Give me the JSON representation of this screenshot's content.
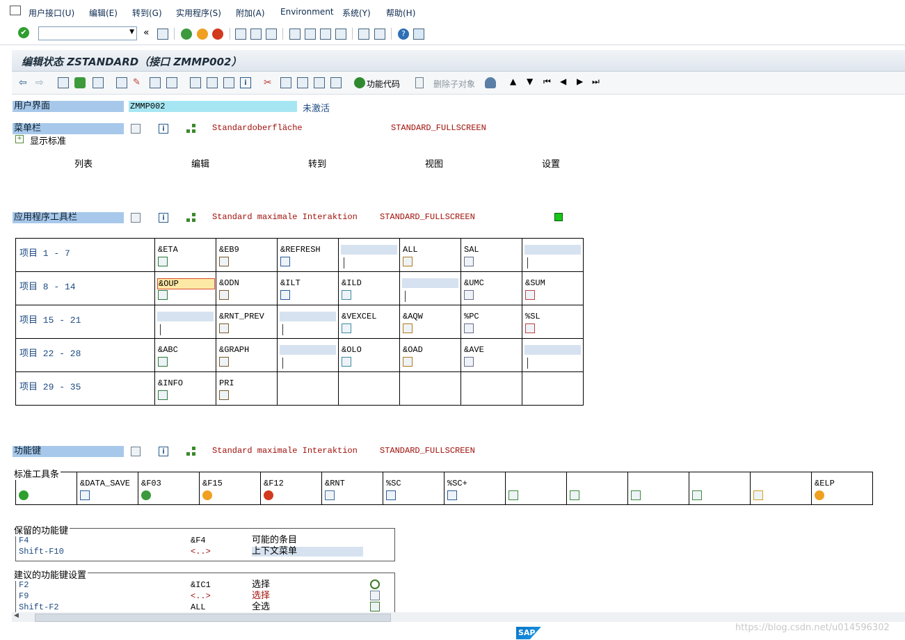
{
  "menu": [
    "用户接口(U)",
    "编辑(E)",
    "转到(G)",
    "实用程序(S)",
    "附加(A)",
    "Environment",
    "系统(Y)",
    "帮助(H)"
  ],
  "window_title": "编辑状态 ZSTANDARD（接口 ZMMP002）",
  "app_toolbar": {
    "func_code_label": "功能代码",
    "delete_sub_label": "删除子对象"
  },
  "ui": {
    "label": "用户界面",
    "value": "ZMMP002",
    "status": "未激活"
  },
  "menubar_section": {
    "label": "菜单栏",
    "text": "Standardoberfläche",
    "code": "STANDARD_FULLSCREEN",
    "show_standard": "显示标准",
    "items": [
      "列表",
      "编辑",
      "转到",
      "视图",
      "设置"
    ]
  },
  "app_toolbar_section": {
    "label": "应用程序工具栏",
    "text": "Standard maximale Interaktion",
    "code": "STANDARD_FULLSCREEN",
    "rows": [
      {
        "label": "项目  1 -  7",
        "cells": [
          "&ETA",
          "&EB9",
          "&REFRESH",
          "",
          "ALL",
          "SAL",
          ""
        ]
      },
      {
        "label": "项目  8 - 14",
        "cells": [
          "&OUP",
          "&ODN",
          "&ILT",
          "&ILD",
          "",
          "&UMC",
          "&SUM"
        ]
      },
      {
        "label": "项目 15 - 21",
        "cells": [
          "",
          "&RNT_PREV",
          "",
          "&VEXCEL",
          "&AQW",
          "%PC",
          "%SL"
        ]
      },
      {
        "label": "项目 22 - 28",
        "cells": [
          "&ABC",
          "&GRAPH",
          "",
          "&OLO",
          "&OAD",
          "&AVE",
          ""
        ]
      },
      {
        "label": "项目 29 - 35",
        "cells": [
          "&INFO",
          "PRI",
          "",
          "",
          "",
          "",
          ""
        ]
      }
    ]
  },
  "function_keys": {
    "label": "功能键",
    "text": "Standard maximale Interaktion",
    "code": "STANDARD_FULLSCREEN",
    "std_toolbar_title": "标准工具条",
    "std_toolbar": [
      "",
      "&DATA_SAVE",
      "&F03",
      "&F15",
      "&F12",
      "&RNT",
      "%SC",
      "%SC+",
      "",
      "",
      "",
      "",
      "",
      "&ELP"
    ]
  },
  "reserved": {
    "title": "保留的功能键",
    "rows": [
      {
        "key": "F4",
        "code": "&F4",
        "desc": "可能的条目"
      },
      {
        "key": "Shift-F10",
        "code": "<..>",
        "desc": "上下文菜单"
      }
    ]
  },
  "suggested": {
    "title": "建议的功能键设置",
    "rows": [
      {
        "key": "F2",
        "code": "&IC1",
        "desc": "选择"
      },
      {
        "key": "F9",
        "code": "<..>",
        "desc": "选择"
      },
      {
        "key": "Shift-F2",
        "code": "ALL",
        "desc": "全选"
      }
    ]
  },
  "status": {
    "logo": "SAP",
    "watermark": "https://blog.csdn.net/u014596302"
  },
  "colors": {
    "section_label_bg": "#a7c8ea",
    "link_blue": "#1c4a82",
    "red_text": "#a0100a",
    "active_green": "#18c618"
  }
}
